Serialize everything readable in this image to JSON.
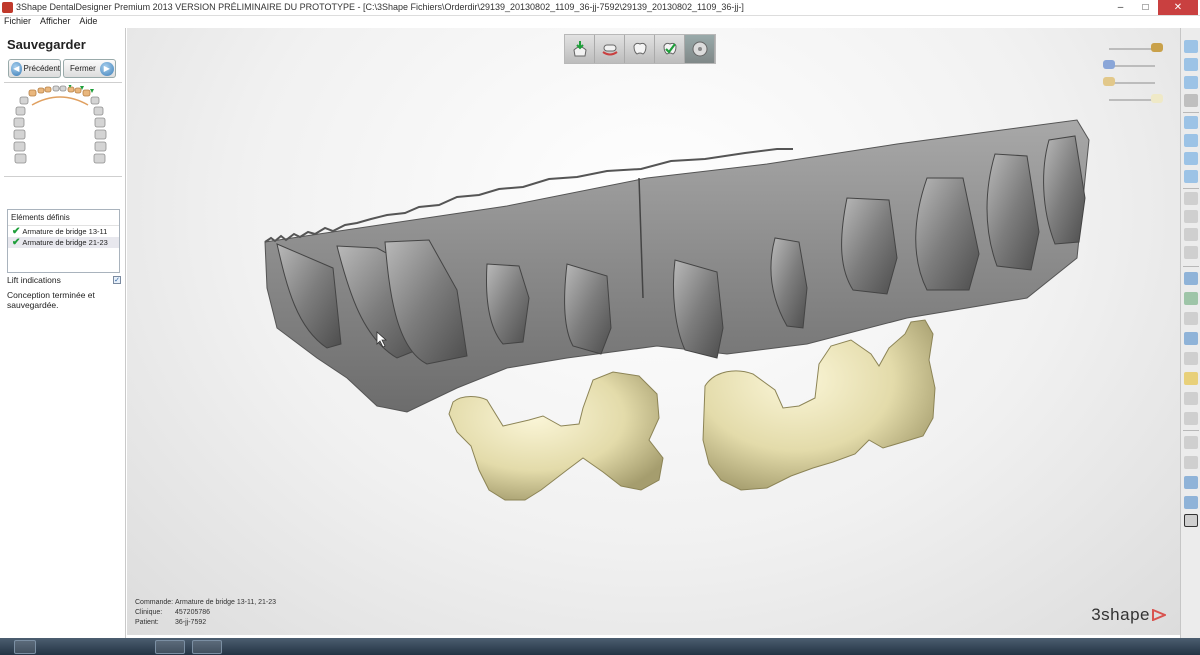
{
  "window": {
    "title": "3Shape DentalDesigner Premium 2013 VERSION PRÉLIMINAIRE DU PROTOTYPE - [C:\\3Shape Fichiers\\Orderdir\\29139_20130802_1109_36-jj-7592\\29139_20130802_1109_36-jj-]",
    "minimize": "–",
    "maximize": "□",
    "close": "✕"
  },
  "menu": [
    "Fichier",
    "Afficher",
    "Aide"
  ],
  "panel": {
    "title": "Sauvegarder",
    "prev_label": "Précédent",
    "close_label": "Fermer",
    "elements_header": "Eléments définis",
    "elements": [
      "Armature de bridge 13-11",
      "Armature de bridge 21-23"
    ],
    "lift_label": "Lift indications",
    "lift_checked": true,
    "status": "Conception terminée et sauvegardée."
  },
  "info": {
    "order_label": "Commande:",
    "order_value": "Armature de bridge 13-11, 21-23",
    "clinic_label": "Clinique:",
    "clinic_value": "457205786",
    "patient_label": "Patient:",
    "patient_value": "36-jj-7592"
  },
  "logo": "3shape",
  "colors": {
    "accent": "#3d7fb8",
    "check": "#1e9e3a",
    "close_button": "#c94040",
    "bridge": "#e6dfb4",
    "teeth_model": "#7e7e7e",
    "logo_triangle": "#d9534f"
  },
  "toolbar_icons": [
    "tooth-upload-icon",
    "crown-icon",
    "tooth-icon",
    "tooth-check-icon",
    "disc-icon"
  ],
  "slider_icons": [
    "upper-jaw-icon",
    "preparation-icon",
    "antagonist-icon",
    "bridge-icon"
  ]
}
